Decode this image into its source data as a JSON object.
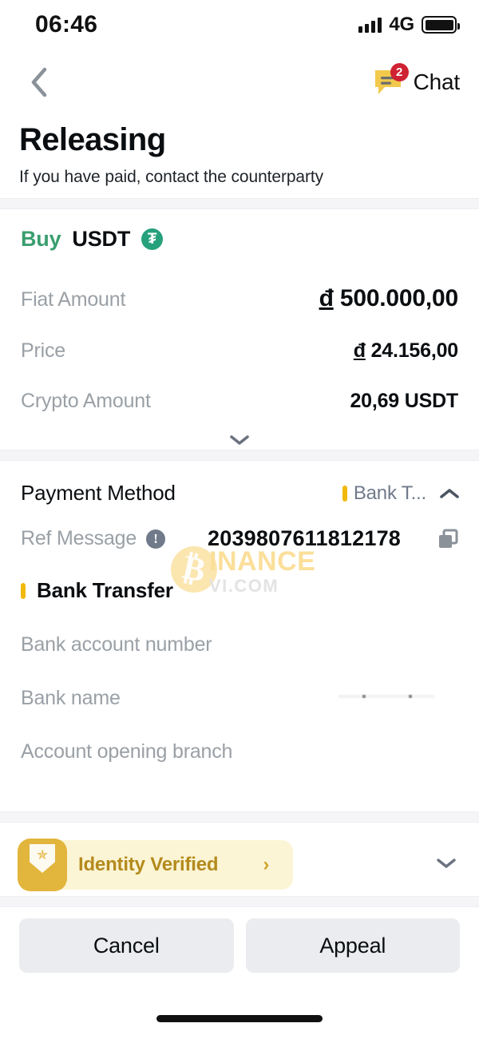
{
  "status_bar": {
    "time": "06:46",
    "network": "4G",
    "signal_icon": "signal-bars-icon",
    "battery_icon": "battery-full-icon"
  },
  "nav": {
    "back_icon": "chevron-left-icon",
    "chat_label": "Chat",
    "chat_icon": "chat-bubble-icon",
    "chat_badge": "2"
  },
  "header": {
    "title": "Releasing",
    "subtitle": "If you have paid, contact the counterparty"
  },
  "order": {
    "side": "Buy",
    "asset": "USDT",
    "asset_icon_symbol": "₮",
    "rows": [
      {
        "label": "Fiat Amount",
        "currency": "đ",
        "value": "500.000,00"
      },
      {
        "label": "Price",
        "currency": "đ",
        "value": "24.156,00"
      },
      {
        "label": "Crypto Amount",
        "currency": "",
        "value": "20,69 USDT"
      }
    ],
    "expand_icon": "chevron-down-icon"
  },
  "payment": {
    "title": "Payment Method",
    "selected_method_short": "Bank T...",
    "collapse_icon": "chevron-up-icon",
    "ref_label": "Ref Message",
    "ref_info_icon": "info-icon",
    "ref_value": "2039807611812178",
    "copy_icon": "copy-icon",
    "method_name": "Bank Transfer",
    "fields": [
      {
        "label": "Bank account number"
      },
      {
        "label": "Bank name"
      },
      {
        "label": "Account opening branch"
      }
    ]
  },
  "watermark": {
    "main": "INANCE",
    "sub": "VI.COM",
    "coin_symbol": "₿"
  },
  "verified": {
    "label": "Identity Verified",
    "badge_icon": "verified-shield-icon",
    "arrow_icon": "chevron-right-icon",
    "collapse_icon": "chevron-down-icon"
  },
  "footer": {
    "cancel_label": "Cancel",
    "appeal_label": "Appeal"
  },
  "colors": {
    "buy_green": "#3a9e6f",
    "usdt_green": "#26a17b",
    "binance_yellow": "#f0b90b",
    "badge_red": "#cf2233",
    "verified_bg": "#fbf5d5",
    "verified_text": "#b48a1d",
    "button_bg": "#eaecef",
    "muted_text": "#9aa0a6"
  }
}
